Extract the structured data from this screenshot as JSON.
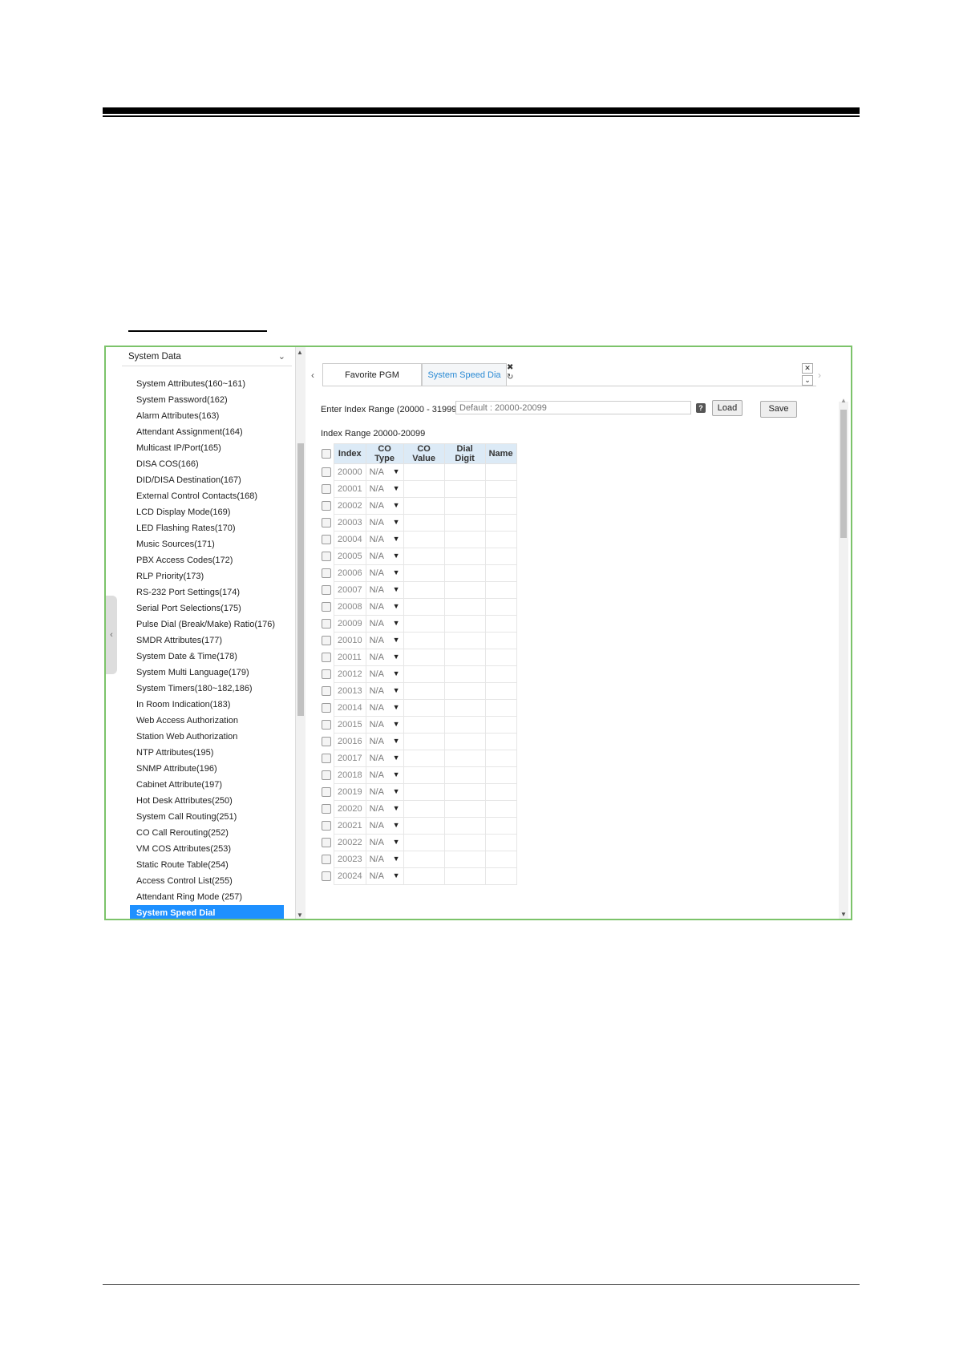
{
  "sidebar": {
    "header": "System Data",
    "items": [
      "System Attributes(160~161)",
      "System Password(162)",
      "Alarm Attributes(163)",
      "Attendant Assignment(164)",
      "Multicast IP/Port(165)",
      "DISA COS(166)",
      "DID/DISA Destination(167)",
      "External Control Contacts(168)",
      "LCD Display Mode(169)",
      "LED Flashing Rates(170)",
      "Music Sources(171)",
      "PBX Access Codes(172)",
      "RLP Priority(173)",
      "RS-232 Port Settings(174)",
      "Serial Port Selections(175)",
      "Pulse Dial (Break/Make) Ratio(176)",
      "SMDR Attributes(177)",
      "System Date & Time(178)",
      "System Multi Language(179)",
      "System Timers(180~182,186)",
      "In Room Indication(183)",
      "Web Access Authorization",
      "Station Web Authorization",
      "NTP Attributes(195)",
      "SNMP Attribute(196)",
      "Cabinet Attribute(197)",
      "Hot Desk Attributes(250)",
      "System Call Routing(251)",
      "CO Call Rerouting(252)",
      "VM COS Attributes(253)",
      "Static Route Table(254)",
      "Access Control List(255)",
      "Attendant Ring Mode (257)"
    ],
    "active_item": "System Speed Dial"
  },
  "tabs": {
    "tab1": "Favorite PGM",
    "tab2": "System Speed Dia"
  },
  "form": {
    "range_label": "Enter Index Range (20000 - 31999) :",
    "range_placeholder": "Default : 20000-20099",
    "load_label": "Load",
    "save_label": "Save",
    "index_range_text": "Index Range 20000-20099"
  },
  "table": {
    "headers": [
      "Index",
      "CO Type",
      "CO Value",
      "Dial Digit",
      "Name"
    ],
    "rows": [
      {
        "index": "20000",
        "co_type": "N/A"
      },
      {
        "index": "20001",
        "co_type": "N/A"
      },
      {
        "index": "20002",
        "co_type": "N/A"
      },
      {
        "index": "20003",
        "co_type": "N/A"
      },
      {
        "index": "20004",
        "co_type": "N/A"
      },
      {
        "index": "20005",
        "co_type": "N/A"
      },
      {
        "index": "20006",
        "co_type": "N/A"
      },
      {
        "index": "20007",
        "co_type": "N/A"
      },
      {
        "index": "20008",
        "co_type": "N/A"
      },
      {
        "index": "20009",
        "co_type": "N/A"
      },
      {
        "index": "20010",
        "co_type": "N/A"
      },
      {
        "index": "20011",
        "co_type": "N/A"
      },
      {
        "index": "20012",
        "co_type": "N/A"
      },
      {
        "index": "20013",
        "co_type": "N/A"
      },
      {
        "index": "20014",
        "co_type": "N/A"
      },
      {
        "index": "20015",
        "co_type": "N/A"
      },
      {
        "index": "20016",
        "co_type": "N/A"
      },
      {
        "index": "20017",
        "co_type": "N/A"
      },
      {
        "index": "20018",
        "co_type": "N/A"
      },
      {
        "index": "20019",
        "co_type": "N/A"
      },
      {
        "index": "20020",
        "co_type": "N/A"
      },
      {
        "index": "20021",
        "co_type": "N/A"
      },
      {
        "index": "20022",
        "co_type": "N/A"
      },
      {
        "index": "20023",
        "co_type": "N/A"
      },
      {
        "index": "20024",
        "co_type": "N/A"
      }
    ]
  },
  "colors": {
    "frame_border": "#7cc36a",
    "active_item_bg": "#1e90ff",
    "active_tab_text": "#2a8ad4",
    "table_header_bg": "#dceaf6"
  }
}
